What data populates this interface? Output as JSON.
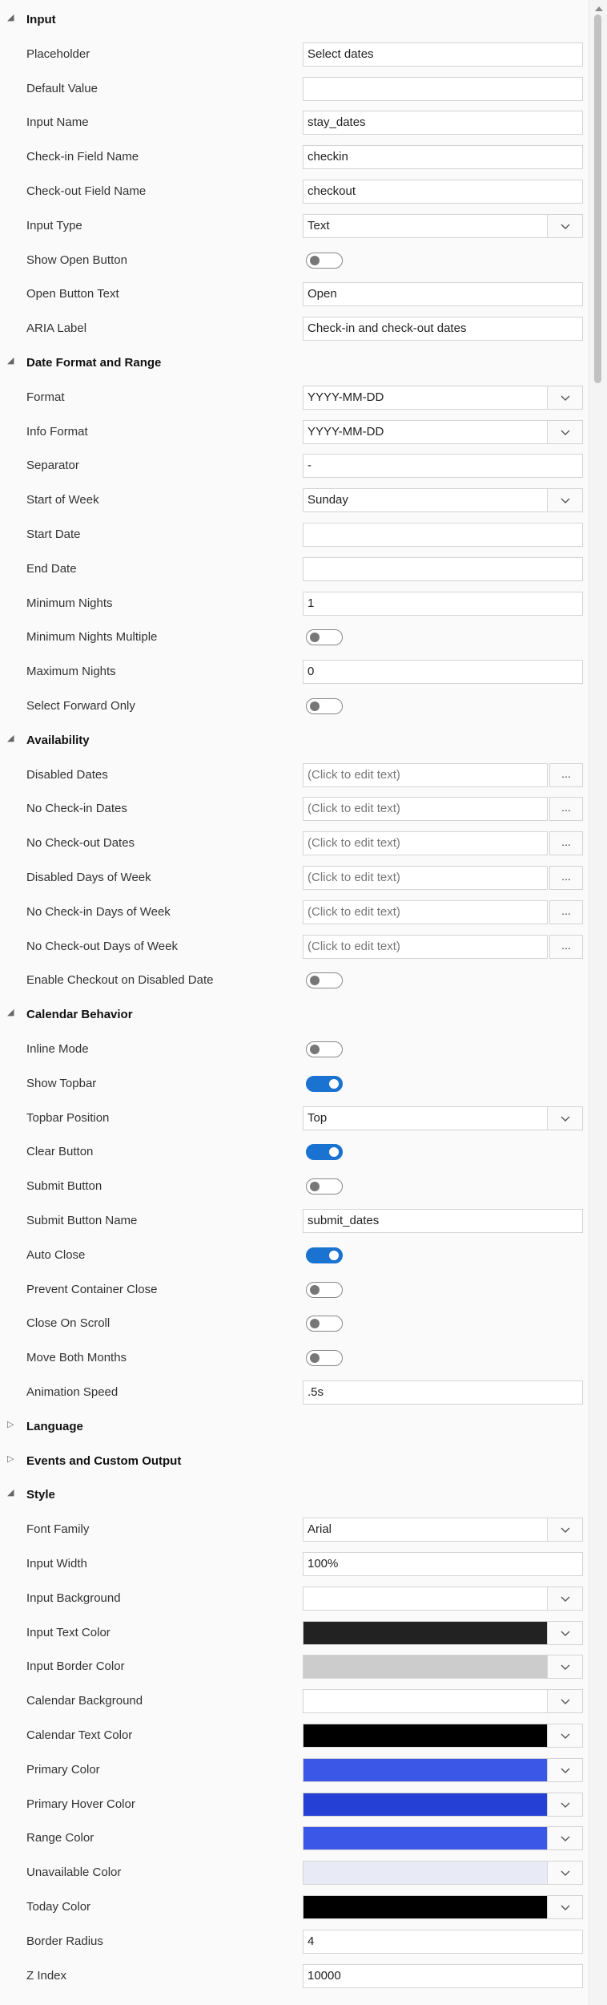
{
  "sections": [
    {
      "title": "Input",
      "expanded": true,
      "rows": [
        {
          "label": "Placeholder",
          "type": "text",
          "value": "Select dates"
        },
        {
          "label": "Default Value",
          "type": "text",
          "value": ""
        },
        {
          "label": "Input Name",
          "type": "text",
          "value": "stay_dates"
        },
        {
          "label": "Check-in Field Name",
          "type": "text",
          "value": "checkin"
        },
        {
          "label": "Check-out Field Name",
          "type": "text",
          "value": "checkout"
        },
        {
          "label": "Input Type",
          "type": "select",
          "value": "Text"
        },
        {
          "label": "Show Open Button",
          "type": "toggle",
          "on": false
        },
        {
          "label": "Open Button Text",
          "type": "text",
          "value": "Open"
        },
        {
          "label": "ARIA Label",
          "type": "text",
          "value": "Check-in and check-out dates"
        }
      ]
    },
    {
      "title": "Date Format and Range",
      "expanded": true,
      "rows": [
        {
          "label": "Format",
          "type": "select",
          "value": "YYYY-MM-DD"
        },
        {
          "label": "Info Format",
          "type": "select",
          "value": "YYYY-MM-DD"
        },
        {
          "label": "Separator",
          "type": "text",
          "value": " - "
        },
        {
          "label": "Start of Week",
          "type": "select",
          "value": "Sunday"
        },
        {
          "label": "Start Date",
          "type": "text",
          "value": ""
        },
        {
          "label": "End Date",
          "type": "text",
          "value": ""
        },
        {
          "label": "Minimum Nights",
          "type": "text",
          "value": "1"
        },
        {
          "label": "Minimum Nights Multiple",
          "type": "toggle",
          "on": false
        },
        {
          "label": "Maximum Nights",
          "type": "text",
          "value": "0"
        },
        {
          "label": "Select Forward Only",
          "type": "toggle",
          "on": false
        }
      ]
    },
    {
      "title": "Availability",
      "expanded": true,
      "rows": [
        {
          "label": "Disabled Dates",
          "type": "edit",
          "value": "(Click to edit text)",
          "button": "..."
        },
        {
          "label": "No Check-in Dates",
          "type": "edit",
          "value": "(Click to edit text)",
          "button": "..."
        },
        {
          "label": "No Check-out Dates",
          "type": "edit",
          "value": "(Click to edit text)",
          "button": "..."
        },
        {
          "label": "Disabled Days of Week",
          "type": "edit",
          "value": "(Click to edit text)",
          "button": "..."
        },
        {
          "label": "No Check-in Days of Week",
          "type": "edit",
          "value": "(Click to edit text)",
          "button": "..."
        },
        {
          "label": "No Check-out Days of Week",
          "type": "edit",
          "value": "(Click to edit text)",
          "button": "..."
        },
        {
          "label": "Enable Checkout on Disabled Date",
          "type": "toggle",
          "on": false
        }
      ]
    },
    {
      "title": "Calendar Behavior",
      "expanded": true,
      "rows": [
        {
          "label": "Inline Mode",
          "type": "toggle",
          "on": false
        },
        {
          "label": "Show Topbar",
          "type": "toggle",
          "on": true
        },
        {
          "label": "Topbar Position",
          "type": "select",
          "value": "Top"
        },
        {
          "label": "Clear Button",
          "type": "toggle",
          "on": true
        },
        {
          "label": "Submit Button",
          "type": "toggle",
          "on": false
        },
        {
          "label": "Submit Button Name",
          "type": "text",
          "value": "submit_dates"
        },
        {
          "label": "Auto Close",
          "type": "toggle",
          "on": true
        },
        {
          "label": "Prevent Container Close",
          "type": "toggle",
          "on": false
        },
        {
          "label": "Close On Scroll",
          "type": "toggle",
          "on": false
        },
        {
          "label": "Move Both Months",
          "type": "toggle",
          "on": false
        },
        {
          "label": "Animation Speed",
          "type": "text",
          "value": ".5s"
        }
      ]
    },
    {
      "title": "Language",
      "expanded": false,
      "rows": []
    },
    {
      "title": "Events and Custom Output",
      "expanded": false,
      "rows": []
    },
    {
      "title": "Style",
      "expanded": true,
      "rows": [
        {
          "label": "Font Family",
          "type": "select",
          "value": "Arial"
        },
        {
          "label": "Input Width",
          "type": "text",
          "value": "100%"
        },
        {
          "label": "Input Background",
          "type": "color",
          "color": "#ffffff"
        },
        {
          "label": "Input Text Color",
          "type": "color",
          "color": "#222222"
        },
        {
          "label": "Input Border Color",
          "type": "color",
          "color": "#cccccc"
        },
        {
          "label": "Calendar Background",
          "type": "color",
          "color": "#ffffff"
        },
        {
          "label": "Calendar Text Color",
          "type": "color",
          "color": "#000000"
        },
        {
          "label": "Primary Color",
          "type": "color",
          "color": "#3a57e8"
        },
        {
          "label": "Primary Hover Color",
          "type": "color",
          "color": "#2540d4"
        },
        {
          "label": "Range Color",
          "type": "color",
          "color": "#3a57e8"
        },
        {
          "label": "Unavailable Color",
          "type": "color",
          "color": "#e8ebf5"
        },
        {
          "label": "Today Color",
          "type": "color",
          "color": "#000000"
        },
        {
          "label": "Border Radius",
          "type": "text",
          "value": "4"
        },
        {
          "label": "Z Index",
          "type": "text",
          "value": "10000"
        }
      ]
    }
  ]
}
